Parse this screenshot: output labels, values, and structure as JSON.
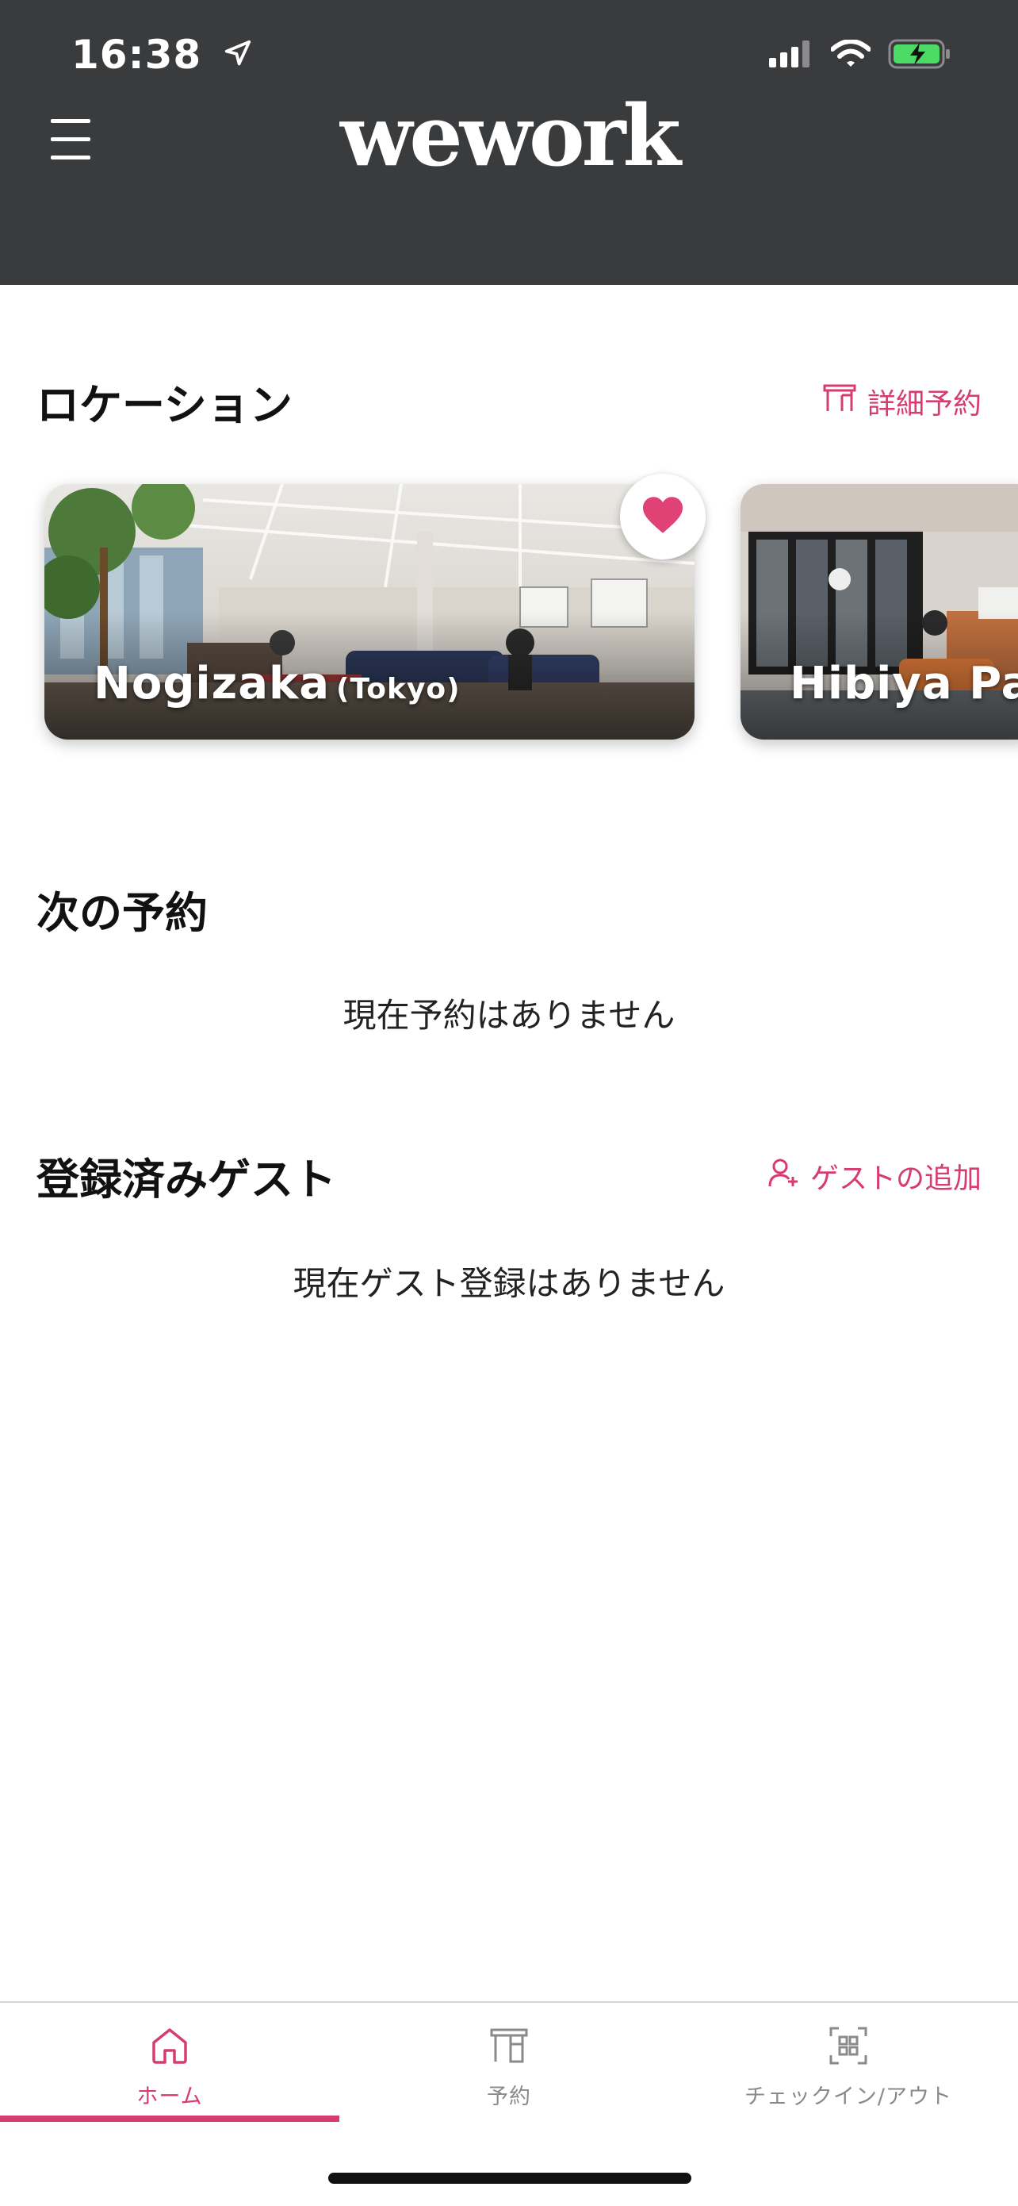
{
  "status_bar": {
    "time": "16:38"
  },
  "header": {
    "logo": "wework"
  },
  "locations": {
    "title": "ロケーション",
    "action_label": "詳細予約",
    "cards": [
      {
        "name": "Nogizaka",
        "city": "(Tokyo)",
        "favorite": true
      },
      {
        "name": "Hibiya Park",
        "city": "",
        "favorite": false
      }
    ]
  },
  "next_booking": {
    "title": "次の予約",
    "empty_text": "現在予約はありません"
  },
  "guests": {
    "title": "登録済みゲスト",
    "action_label": "ゲストの追加",
    "empty_text": "現在ゲスト登録はありません"
  },
  "tabbar": {
    "tabs": [
      {
        "label": "ホーム",
        "icon": "home-icon",
        "active": true
      },
      {
        "label": "予約",
        "icon": "desk-icon",
        "active": false
      },
      {
        "label": "チェックイン/アウト",
        "icon": "qr-scan-icon",
        "active": false
      }
    ]
  },
  "colors": {
    "accent": "#d63d6e",
    "header_bg": "#3a3b3d",
    "battery": "#4cd964"
  }
}
